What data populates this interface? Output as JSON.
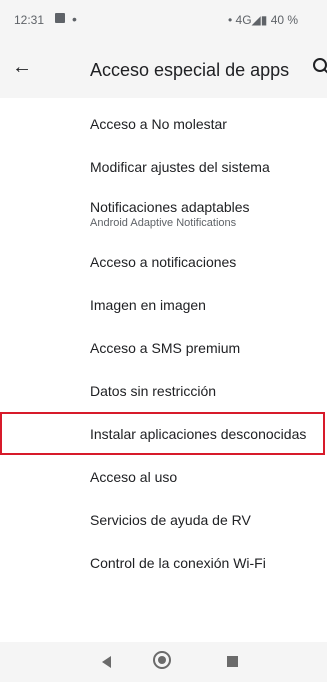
{
  "status_bar": {
    "time": "12:31",
    "dot": "•",
    "right": "• 4G◢▮ 40 %"
  },
  "app_bar": {
    "back_glyph": "←",
    "title": "Acceso especial de apps"
  },
  "list": {
    "items": [
      {
        "label": "Acceso a No molestar"
      },
      {
        "label": "Modificar ajustes del sistema"
      },
      {
        "label": "Notificaciones adaptables",
        "sublabel": "Android Adaptive Notifications"
      },
      {
        "label": "Acceso a notificaciones"
      },
      {
        "label": "Imagen en imagen"
      },
      {
        "label": "Acceso a SMS premium"
      },
      {
        "label": "Datos sin restricción"
      },
      {
        "label": "Instalar aplicaciones desconocidas"
      },
      {
        "label": "Acceso al uso"
      },
      {
        "label": "Servicios de ayuda de RV"
      },
      {
        "label": "Control de la conexión Wi-Fi"
      }
    ]
  },
  "colors": {
    "highlight_border": "#d71a2a",
    "bar_background": "#f5f5f5"
  }
}
